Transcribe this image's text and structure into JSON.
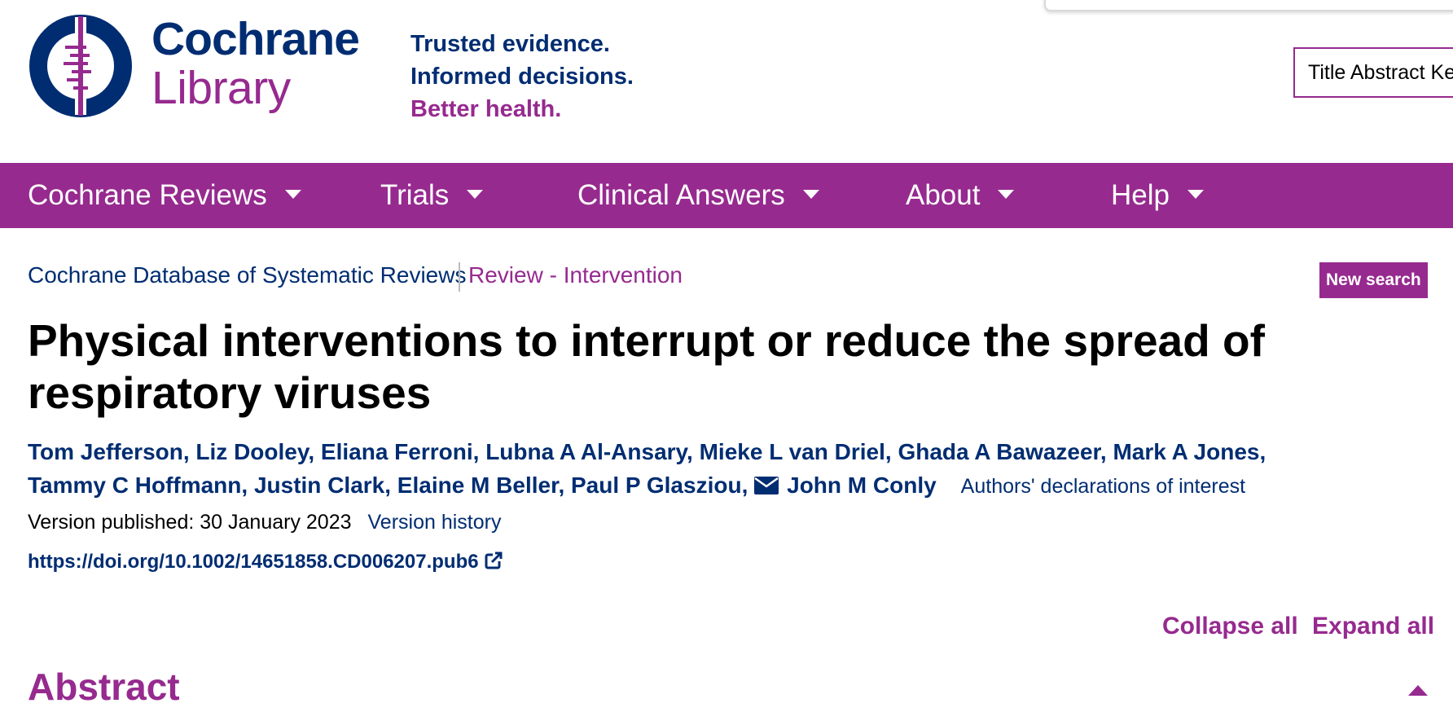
{
  "brand": {
    "line1": "Cochrane",
    "line2": "Library",
    "tagline": [
      "Trusted evidence.",
      "Informed decisions.",
      "Better health."
    ]
  },
  "search": {
    "value": "Title Abstract Keyword"
  },
  "nav": {
    "items": [
      {
        "label": "Cochrane Reviews"
      },
      {
        "label": "Trials"
      },
      {
        "label": "Clinical Answers"
      },
      {
        "label": "About"
      },
      {
        "label": "Help"
      }
    ]
  },
  "breadcrumb": {
    "database": "Cochrane Database of Systematic Reviews",
    "type": "Review - Intervention",
    "new_search": "New search"
  },
  "article": {
    "title": "Physical interventions to interrupt or reduce the spread of respiratory viruses",
    "authors": [
      "Tom Jefferson",
      "Liz Dooley",
      "Eliana Ferroni",
      "Lubna A Al-Ansary",
      "Mieke L van Driel",
      "Ghada A Bawazeer",
      "Mark A Jones",
      "Tammy C Hoffmann",
      "Justin Clark",
      "Elaine M Beller",
      "Paul P Glasziou",
      "John M Conly"
    ],
    "declarations": "Authors' declarations of interest",
    "version_published": "Version published: 30 January 2023",
    "version_history": "Version history",
    "doi": "https://doi.org/10.1002/14651858.CD006207.pub6"
  },
  "controls": {
    "collapse_all": "Collapse all",
    "expand_all": "Expand all"
  },
  "sections": {
    "abstract": "Abstract"
  },
  "colors": {
    "navy": "#002d72",
    "purple": "#962a8f"
  },
  "icons": [
    "cochrane-logo-icon",
    "caret-down-icon",
    "envelope-icon",
    "external-link-icon",
    "caret-up-icon"
  ]
}
